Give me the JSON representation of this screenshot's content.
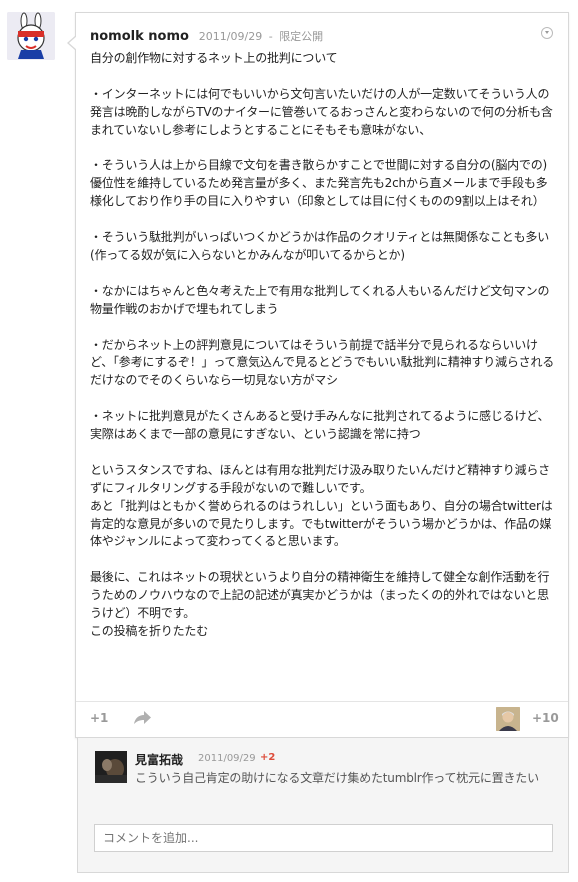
{
  "post": {
    "author": "nomolk nomo",
    "date": "2011/09/29",
    "separator": "-",
    "visibility": "限定公開",
    "body": "自分の創作物に対するネット上の批判について\n\n・インターネットには何でもいいから文句言いたいだけの人が一定数いてそういう人の発言は晩酌しながらTVのナイターに管巻いてるおっさんと変わらないので何の分析も含まれていないし参考にしようとすることにそもそも意味がない、\n\n・そういう人は上から目線で文句を書き散らかすことで世間に対する自分の(脳内での)優位性を維持しているため発言量が多く、また発言先も2chから直メールまで手段も多様化しており作り手の目に入りやすい（印象としては目に付くものの9割以上はそれ）\n\n・そういう駄批判がいっぱいつくかどうかは作品のクオリティとは無関係なことも多い(作ってる奴が気に入らないとかみんなが叩いてるからとか)\n\n・なかにはちゃんと色々考えた上で有用な批判してくれる人もいるんだけど文句マンの物量作戦のおかげで埋もれてしまう\n\n・だからネット上の評判意見についてはそういう前提で話半分で見られるならいいけど、「参考にするぞ！」って意気込んで見るとどうでもいい駄批判に精神すり減らされるだけなのでそのくらいなら一切見ない方がマシ\n\n・ネットに批判意見がたくさんあると受け手みんなに批判されてるように感じるけど、実際はあくまで一部の意見にすぎない、という認識を常に持つ\n\nというスタンスですね、ほんとは有用な批判だけ汲み取りたいんだけど精神すり減らさずにフィルタリングする手段がないので難しいです。\nあと「批判はともかく誉められるのはうれしい」という面もあり、自分の場合twitterは肯定的な意見が多いので見たりします。でもtwitterがそういう場かどうかは、作品の媒体やジャンルによって変わってくると思います。\n\n最後に、これはネットの現状というより自分の精神衛生を維持して健全な創作活動を行うためのノウハウなので上記の記述が真実かどうかは（まったくの的外れではないと思うけど）不明です。\nこの投稿を折りたたむ",
    "plus_one_label": "+1",
    "plus_count": "+10",
    "icons": {
      "menu": "dropdown-circle-icon",
      "share": "share-arrow-icon"
    }
  },
  "comment": {
    "author": "見富拓哉",
    "date": "2011/09/29",
    "plus": "+2",
    "text": "こういう自己肯定の助けになる文章だけ集めたtumblr作って枕元に置きたい"
  },
  "add_comment": {
    "placeholder": "コメントを追加..."
  },
  "colors": {
    "accent_plus": "#dd4b39",
    "meta": "#999999",
    "border": "#d8d8d8"
  }
}
